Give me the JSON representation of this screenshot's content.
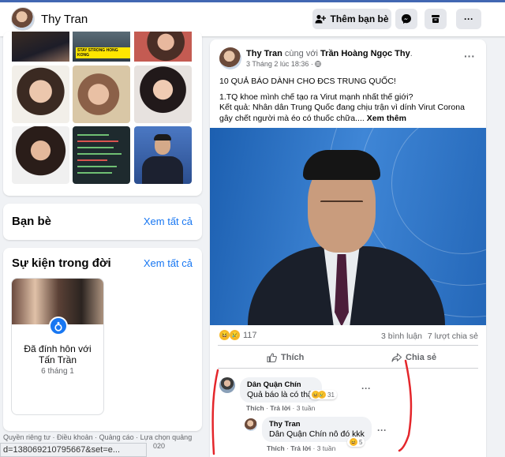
{
  "topbar": {
    "profile_name": "Thy Tran",
    "add_friend_label": "Thêm bạn bè",
    "add_friend_icon": "person-plus-icon",
    "messenger_icon": "messenger-icon",
    "save_icon": "box-icon",
    "more_icon": "more-icon",
    "more_label": "···",
    "accent": "#4267b2"
  },
  "photos": {
    "caption": "STAY STRONG HONG KONG"
  },
  "friends": {
    "title": "Bạn bè",
    "see_all": "Xem tất cả"
  },
  "life_events": {
    "title": "Sự kiện trong đời",
    "see_all": "Xem tất cả",
    "event_title": "Đã đính hôn với Tấn Trần",
    "event_date": "6 tháng 1",
    "event_icon": "ring-icon"
  },
  "footer": {
    "links": "Quyền riêng tư · Điều khoản · Quảng cáo · Lựa chọn quảng",
    "trailing": "020"
  },
  "status_url": "d=138069210795667&set=e...",
  "post": {
    "author": "Thy Tran",
    "with_text": "cùng với",
    "tagged": "Trần Hoàng Ngọc Thy",
    "time": "3 Tháng 2 lúc 18:36 ·",
    "globe_icon": "globe-icon",
    "more_label": "···",
    "headline": "10 QUẢ BÁO DÀNH CHO ĐCS TRUNG QUỐC!",
    "line1": "1.TQ khoe mình chế tạo ra Virut mạnh nhất thế giới?",
    "line2": "Kết quả: Nhân dân Trung Quốc đang chịu trận vì dính Virut Corona gây chết người mà éo có thuốc chữa....",
    "see_more": "Xem thêm",
    "reaction_count": "117",
    "comments_count": "3 bình luận",
    "shares_count": "7 lượt chia sẻ",
    "like_label": "Thích",
    "like_icon": "thumbs-up-icon",
    "share_label": "Chia sẻ",
    "share_icon": "share-icon",
    "comments": [
      {
        "name": "Dân Quận Chín",
        "text": "Quả báo là có thật",
        "reactions": "31",
        "like": "Thích",
        "reply": "Trả lời",
        "age": "3 tuần"
      },
      {
        "name": "Thy Tran",
        "text": "Dân Quận Chín nô đó kkk",
        "reactions": "5",
        "like": "Thích",
        "reply": "Trả lời",
        "age": "3 tuần"
      }
    ]
  },
  "colors": {
    "link": "#1877f2",
    "annotation": "#e4262b"
  }
}
